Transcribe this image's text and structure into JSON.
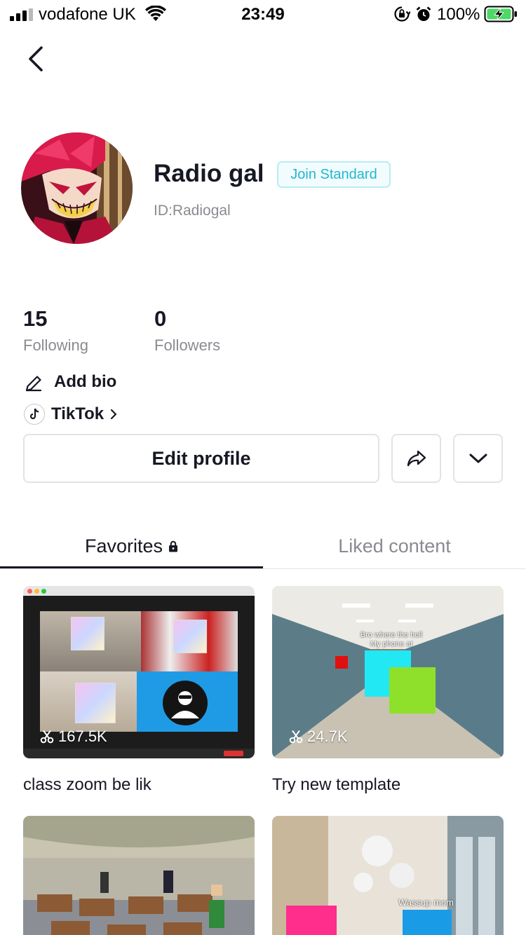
{
  "status_bar": {
    "carrier": "vodafone UK",
    "time": "23:49",
    "battery_percent": "100%"
  },
  "profile": {
    "display_name": "Radio gal",
    "join_badge": "Join Standard",
    "user_id": "ID:Radiogal"
  },
  "stats": [
    {
      "value": "15",
      "label": "Following"
    },
    {
      "value": "0",
      "label": "Followers"
    }
  ],
  "bio": {
    "add_bio_label": "Add bio",
    "link_label": "TikTok"
  },
  "actions": {
    "edit_profile_label": "Edit profile"
  },
  "tabs": [
    {
      "label": "Favorites",
      "active": true,
      "locked": true
    },
    {
      "label": "Liked content",
      "active": false
    }
  ],
  "videos": [
    {
      "title": "class zoom be lik",
      "count": "167.5K"
    },
    {
      "title": "Try new template",
      "count": "24.7K"
    },
    {
      "title": "",
      "count": ""
    },
    {
      "title": "",
      "count": ""
    }
  ],
  "card_overlay_text": {
    "hallway": "Bro where the hell\nMy phone at",
    "lobby": "Wassup mom"
  },
  "colors": {
    "accent_cyan": "#20b8d0",
    "text_primary": "#161823",
    "text_secondary": "#8a8b91",
    "border": "#e3e3e4"
  }
}
